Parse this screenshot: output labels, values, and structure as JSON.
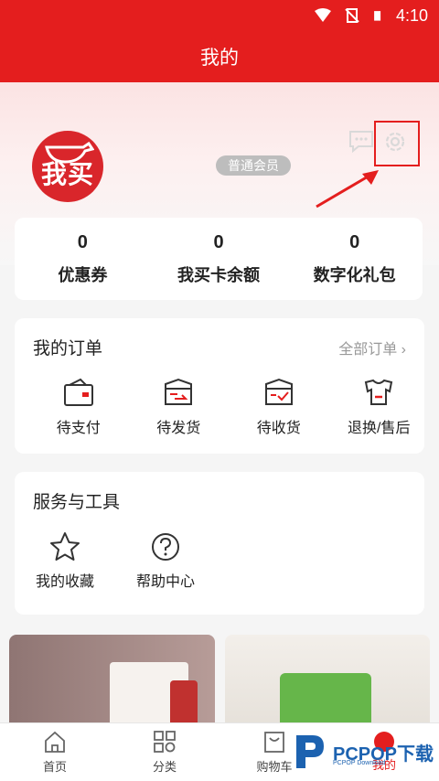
{
  "status_bar": {
    "time": "4:10"
  },
  "header": {
    "title": "我的"
  },
  "profile": {
    "logo_text": "我买",
    "member_badge": "普通会员",
    "icons": [
      "message-icon",
      "settings-icon"
    ]
  },
  "stats": [
    {
      "value": "0",
      "label": "优惠券"
    },
    {
      "value": "0",
      "label": "我买卡余额"
    },
    {
      "value": "0",
      "label": "数字化礼包"
    }
  ],
  "orders": {
    "title": "我的订单",
    "all_link": "全部订单",
    "items": [
      {
        "label": "待支付",
        "icon": "wallet-icon"
      },
      {
        "label": "待发货",
        "icon": "box-ship-icon"
      },
      {
        "label": "待收货",
        "icon": "box-receive-icon"
      },
      {
        "label": "退换/售后",
        "icon": "return-icon"
      }
    ]
  },
  "tools": {
    "title": "服务与工具",
    "items": [
      {
        "label": "我的收藏",
        "icon": "star-icon"
      },
      {
        "label": "帮助中心",
        "icon": "help-icon"
      }
    ]
  },
  "tabs": [
    {
      "label": "首页",
      "icon": "home-icon"
    },
    {
      "label": "分类",
      "icon": "category-icon"
    },
    {
      "label": "购物车",
      "icon": "cart-icon"
    },
    {
      "label": "我的",
      "icon": "profile-icon",
      "active": true
    }
  ],
  "watermark": {
    "text": "PCPOP下载",
    "sub": "PCPOP Download"
  },
  "colors": {
    "accent": "#e41e1e",
    "muted": "#999999"
  }
}
